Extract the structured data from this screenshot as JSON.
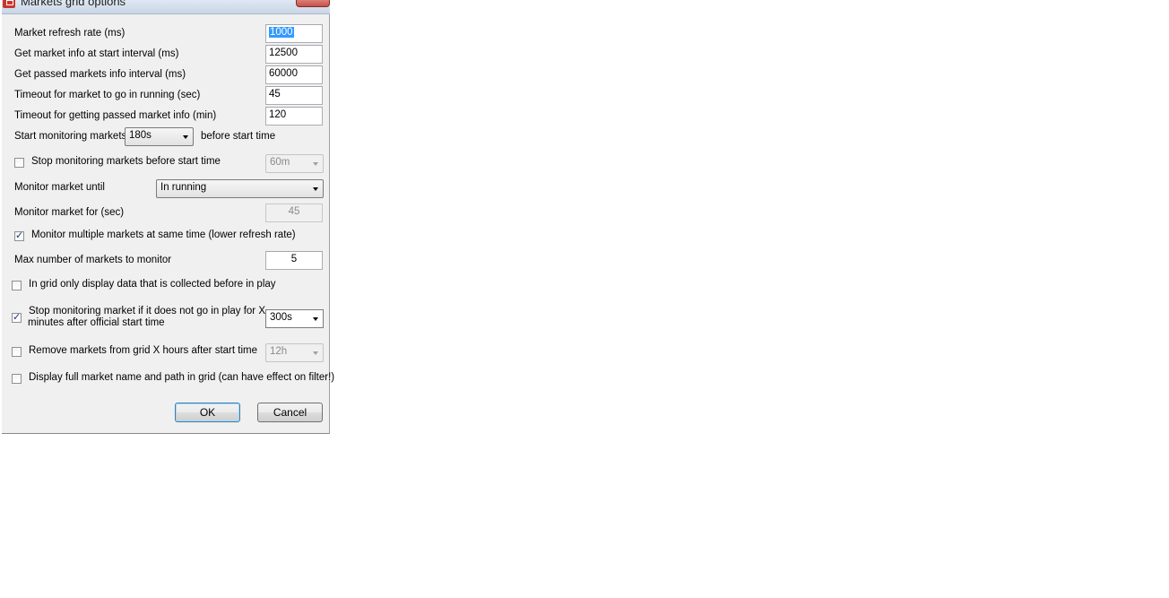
{
  "window": {
    "title": "Markets grid options"
  },
  "fields": {
    "refresh_rate": {
      "label": "Market refresh rate (ms)",
      "value": "1000"
    },
    "start_interval": {
      "label": "Get market info at start interval (ms)",
      "value": "12500"
    },
    "passed_interval": {
      "label": "Get passed markets info interval (ms)",
      "value": "60000"
    },
    "timeout_running": {
      "label": "Timeout for market to go in running (sec)",
      "value": "45"
    },
    "timeout_passed": {
      "label": "Timeout for getting passed market info (min)",
      "value": "120"
    },
    "start_monitoring": {
      "label": "Start monitoring markets",
      "value": "180s",
      "suffix": "before start time"
    },
    "stop_before_start": {
      "label": "Stop monitoring markets before start time",
      "checked": false,
      "value": "60m"
    },
    "monitor_until": {
      "label": "Monitor market until",
      "value": "In running"
    },
    "monitor_for": {
      "label": "Monitor market for (sec)",
      "value": "45"
    },
    "multiple_markets": {
      "label": "Monitor multiple markets at same time (lower refresh rate)",
      "checked": true
    },
    "max_markets": {
      "label": "Max number of markets to monitor",
      "value": "5"
    },
    "grid_before_play": {
      "label": "In grid only display data that is collected before in play",
      "checked": false
    },
    "stop_not_in_play": {
      "label_line1": "Stop monitoring market if it does not go in play for X",
      "label_line2": "minutes after official start time",
      "checked": true,
      "value": "300s"
    },
    "remove_markets": {
      "label": "Remove markets from grid X hours after start time",
      "checked": false,
      "value": "12h"
    },
    "full_name": {
      "label": "Display full market name and path in grid (can have effect on filter!)",
      "checked": false
    }
  },
  "buttons": {
    "ok": "OK",
    "cancel": "Cancel"
  },
  "icons": {
    "title": "app-icon",
    "check": "✓"
  }
}
